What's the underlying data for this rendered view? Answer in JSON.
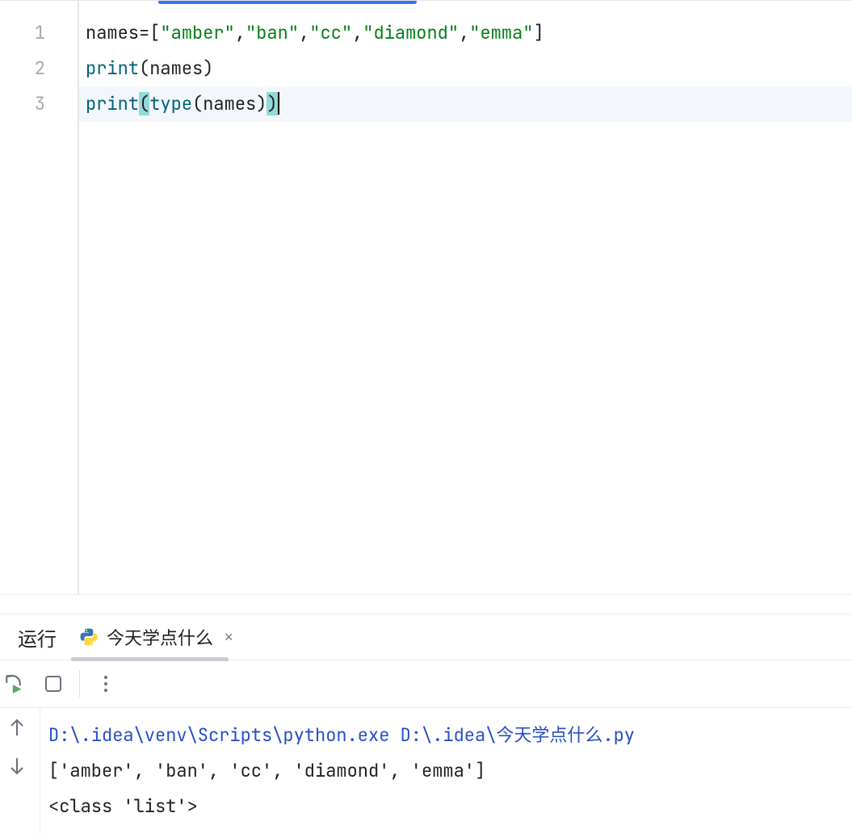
{
  "editor": {
    "line_numbers": [
      "1",
      "2",
      "3"
    ],
    "lines": [
      {
        "tokens": [
          {
            "t": "names",
            "c": "tok-id"
          },
          {
            "t": "=[",
            "c": "tok-op"
          },
          {
            "t": "\"amber\"",
            "c": "tok-str"
          },
          {
            "t": ",",
            "c": "tok-op"
          },
          {
            "t": "\"ban\"",
            "c": "tok-str"
          },
          {
            "t": ",",
            "c": "tok-op"
          },
          {
            "t": "\"cc\"",
            "c": "tok-str"
          },
          {
            "t": ",",
            "c": "tok-op"
          },
          {
            "t": "\"diamond\"",
            "c": "tok-str"
          },
          {
            "t": ",",
            "c": "tok-op"
          },
          {
            "t": "\"emma\"",
            "c": "tok-str"
          },
          {
            "t": "]",
            "c": "tok-op"
          }
        ]
      },
      {
        "tokens": [
          {
            "t": "print",
            "c": "tok-fn"
          },
          {
            "t": "(names)",
            "c": "tok-op"
          }
        ]
      },
      {
        "current": true,
        "tokens": [
          {
            "t": "print",
            "c": "tok-fn"
          },
          {
            "t": "(",
            "c": "tok-op bracket-match"
          },
          {
            "t": "type",
            "c": "tok-fn"
          },
          {
            "t": "(names)",
            "c": "tok-op"
          },
          {
            "t": ")",
            "c": "tok-op bracket-match"
          }
        ],
        "cursor_after": true
      }
    ]
  },
  "run": {
    "panel_label": "运行",
    "tab_title": "今天学点什么",
    "close_glyph": "×",
    "console_lines": [
      {
        "kind": "path",
        "text": "D:\\.idea\\venv\\Scripts\\python.exe D:\\.idea\\今天学点什么.py"
      },
      {
        "kind": "text",
        "text": "['amber', 'ban', 'cc', 'diamond', 'emma']"
      },
      {
        "kind": "text",
        "text": "<class 'list'>"
      }
    ]
  }
}
